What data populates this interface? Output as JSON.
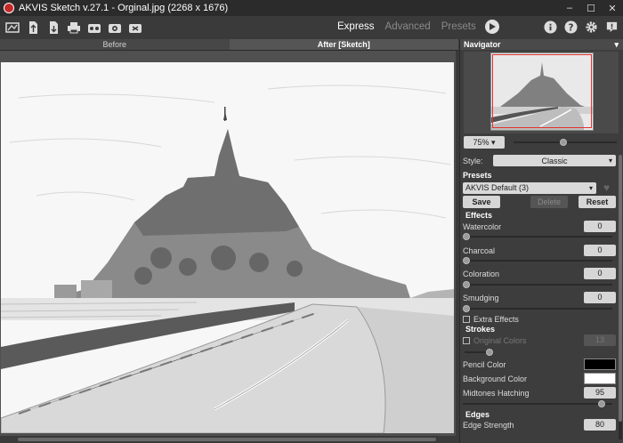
{
  "window": {
    "title": "AKVIS Sketch v.27.1 - Orginal.jpg (2268 x 1676)",
    "minimize": "–",
    "maximize": "☐",
    "close": "✕"
  },
  "toolbar": {
    "icons": [
      "open-icon",
      "load-icon",
      "save-icon",
      "print-icon",
      "batch-icon",
      "share-icon",
      "plugin-icon"
    ],
    "modes": {
      "express": "Express",
      "advanced": "Advanced",
      "presets": "Presets"
    },
    "right_icons": [
      "info-icon",
      "help-icon",
      "settings-icon",
      "notification-icon"
    ]
  },
  "tabs": {
    "before": "Before",
    "after": "After [Sketch]"
  },
  "navigator": {
    "title": "Navigator",
    "zoom": "75%"
  },
  "settings": {
    "style_label": "Style:",
    "style_value": "Classic",
    "presets_label": "Presets",
    "preset_value": "AKVIS Default (3)",
    "save": "Save",
    "delete": "Delete",
    "reset": "Reset",
    "effects_label": "Effects",
    "effects": [
      {
        "label": "Watercolor",
        "value": "0"
      },
      {
        "label": "Charcoal",
        "value": "0"
      },
      {
        "label": "Coloration",
        "value": "0"
      },
      {
        "label": "Smudging",
        "value": "0"
      }
    ],
    "extra_effects": "Extra Effects",
    "strokes_label": "Strokes",
    "original_colors": "Original Colors",
    "original_colors_value": "13",
    "pencil_color": "Pencil Color",
    "pencil_color_hex": "#000000",
    "background_color": "Background Color",
    "background_color_hex": "#ffffff",
    "midtones_hatching": "Midtones Hatching",
    "midtones_value": "95",
    "edges_label": "Edges",
    "edge_strength": "Edge Strength",
    "edge_value": "80"
  }
}
